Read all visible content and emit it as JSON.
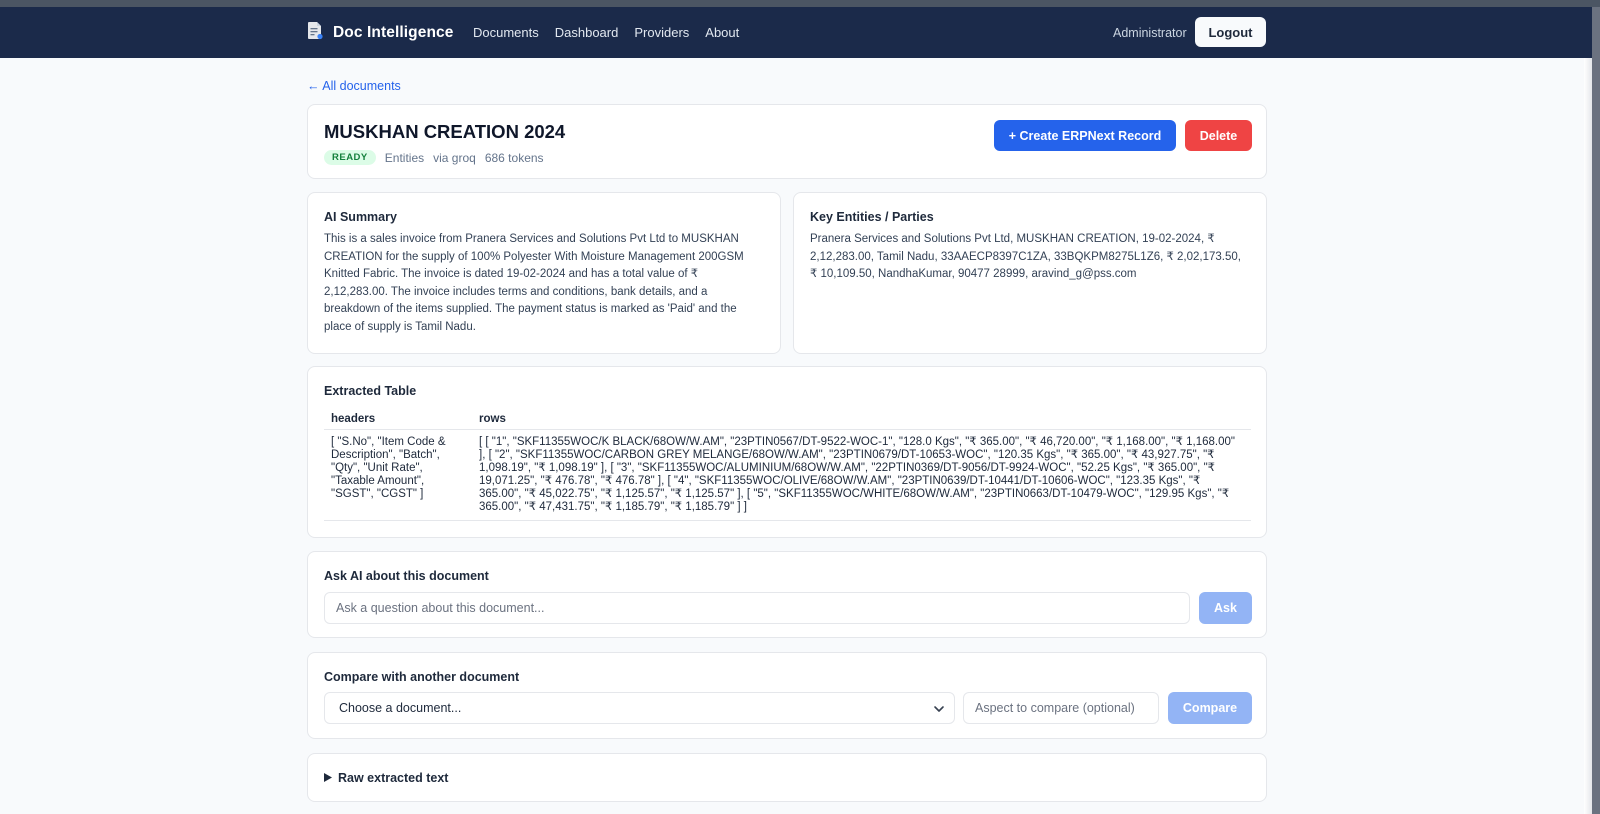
{
  "nav": {
    "brand": "Doc Intelligence",
    "links": [
      "Documents",
      "Dashboard",
      "Providers",
      "About"
    ],
    "user": "Administrator",
    "logout": "Logout"
  },
  "back_link": "← All documents",
  "document": {
    "title": "MUSKHAN CREATION 2024",
    "status": "READY",
    "type": "Entities",
    "provider": "via groq",
    "tokens": "686 tokens",
    "create_button": "+ Create ERPNext Record",
    "delete_button": "Delete"
  },
  "summary": {
    "title": "AI Summary",
    "text": "This is a sales invoice from Pranera Services and Solutions Pvt Ltd to MUSKHAN CREATION for the supply of 100% Polyester With Moisture Management 200GSM Knitted Fabric. The invoice is dated 19-02-2024 and has a total value of ₹ 2,12,283.00. The invoice includes terms and conditions, bank details, and a breakdown of the items supplied. The payment status is marked as 'Paid' and the place of supply is Tamil Nadu."
  },
  "entities": {
    "title": "Key Entities / Parties",
    "text": "Pranera Services and Solutions Pvt Ltd, MUSKHAN CREATION, 19-02-2024, ₹ 2,12,283.00, Tamil Nadu, 33AAECP8397C1ZA, 33BQKPM8275L1Z6, ₹ 2,02,173.50, ₹ 10,109.50, NandhaKumar, 90477 28999, aravind_g@pss.com"
  },
  "extracted_table": {
    "title": "Extracted Table",
    "columns": [
      "headers",
      "rows"
    ],
    "row": {
      "headers": "[ \"S.No\", \"Item Code & Description\", \"Batch\", \"Qty\", \"Unit Rate\", \"Taxable Amount\", \"SGST\", \"CGST\" ]",
      "rows": "[ [ \"1\", \"SKF11355WOC/K BLACK/68OW/W.AM\", \"23PTIN0567/DT-9522-WOC-1\", \"128.0 Kgs\", \"₹ 365.00\", \"₹ 46,720.00\", \"₹ 1,168.00\", \"₹ 1,168.00\" ], [ \"2\", \"SKF11355WOC/CARBON GREY MELANGE/68OW/W.AM\", \"23PTIN0679/DT-10653-WOC\", \"120.35 Kgs\", \"₹ 365.00\", \"₹ 43,927.75\", \"₹ 1,098.19\", \"₹ 1,098.19\" ], [ \"3\", \"SKF11355WOC/ALUMINIUM/68OW/W.AM\", \"22PTIN0369/DT-9056/DT-9924-WOC\", \"52.25 Kgs\", \"₹ 365.00\", \"₹ 19,071.25\", \"₹ 476.78\", \"₹ 476.78\" ], [ \"4\", \"SKF11355WOC/OLIVE/68OW/W.AM\", \"23PTIN0639/DT-10441/DT-10606-WOC\", \"123.35 Kgs\", \"₹ 365.00\", \"₹ 45,022.75\", \"₹ 1,125.57\", \"₹ 1,125.57\" ], [ \"5\", \"SKF11355WOC/WHITE/68OW/W.AM\", \"23PTIN0663/DT-10479-WOC\", \"129.95 Kgs\", \"₹ 365.00\", \"₹ 47,431.75\", \"₹ 1,185.79\", \"₹ 1,185.79\" ] ]"
    }
  },
  "ask": {
    "title": "Ask AI about this document",
    "placeholder": "Ask a question about this document...",
    "button": "Ask"
  },
  "compare": {
    "title": "Compare with another document",
    "select_value": "Choose a document...",
    "aspect_placeholder": "Aspect to compare (optional)",
    "button": "Compare"
  },
  "raw": {
    "label": "Raw extracted text"
  },
  "colors": {
    "navbar": "#1b2a4a",
    "primary": "#2563eb",
    "danger": "#ef4444",
    "ready_badge_bg": "#dcfce7",
    "ready_badge_fg": "#15803d",
    "disabled_button": "#93b4f5"
  }
}
